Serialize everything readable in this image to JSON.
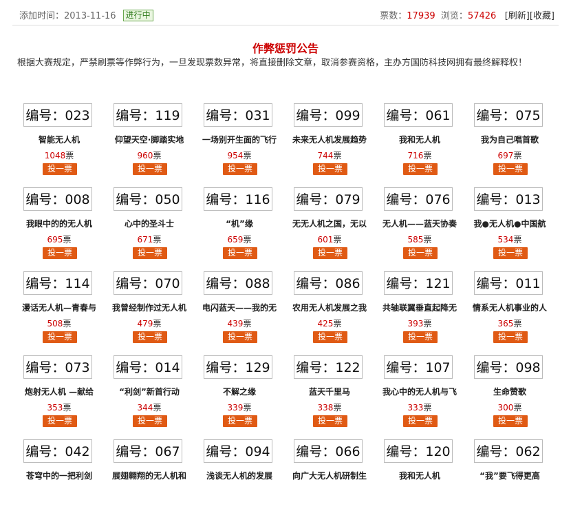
{
  "header": {
    "added_label": "添加时间：2013-11-16",
    "status_badge": "进行中",
    "votes_label": "票数：",
    "votes_value": "17939",
    "views_label": "浏览：",
    "views_value": "57426",
    "refresh_label": "[刷新]",
    "favorite_label": "[收藏]"
  },
  "notice": {
    "title": "作弊惩罚公告",
    "text": "根据大赛规定，严禁刷票等作弊行为，一旦发现票数异常，将直接删除文章，取消参赛资格，主办方国防科技网拥有最终解释权！"
  },
  "vote_button_label": "投一票",
  "votes_suffix": "票",
  "entries": [
    {
      "number": "编号：023",
      "title": "智能无人机",
      "votes": "1048"
    },
    {
      "number": "编号：119",
      "title": "仰望天空·脚踏实地",
      "votes": "960"
    },
    {
      "number": "编号：031",
      "title": "一场别开生面的飞行",
      "votes": "954"
    },
    {
      "number": "编号：099",
      "title": "未来无人机发展趋势",
      "votes": "744"
    },
    {
      "number": "编号：061",
      "title": "我和无人机",
      "votes": "716"
    },
    {
      "number": "编号：075",
      "title": "我为自己唱首歌",
      "votes": "697"
    },
    {
      "number": "编号：008",
      "title": "我眼中的的无人机",
      "votes": "695"
    },
    {
      "number": "编号：050",
      "title": "心中的圣斗士",
      "votes": "671"
    },
    {
      "number": "编号：116",
      "title": "“机”缘",
      "votes": "659"
    },
    {
      "number": "编号：079",
      "title": "无无人机之国，无以",
      "votes": "601"
    },
    {
      "number": "编号：076",
      "title": "无人机——蓝天协奏",
      "votes": "585"
    },
    {
      "number": "编号：013",
      "title": "我●无人机●中国航",
      "votes": "534"
    },
    {
      "number": "编号：114",
      "title": "漫话无人机—青春与",
      "votes": "508"
    },
    {
      "number": "编号：070",
      "title": "我曾经制作过无人机",
      "votes": "479"
    },
    {
      "number": "编号：088",
      "title": "电闪蓝天——我的无",
      "votes": "439"
    },
    {
      "number": "编号：086",
      "title": "农用无人机发展之我",
      "votes": "425"
    },
    {
      "number": "编号：121",
      "title": "共轴联翼垂直起降无",
      "votes": "393"
    },
    {
      "number": "编号：011",
      "title": "情系无人机事业的人",
      "votes": "365"
    },
    {
      "number": "编号：073",
      "title": "炮射无人机 —献给",
      "votes": "353"
    },
    {
      "number": "编号：014",
      "title": "“利剑”新首行动",
      "votes": "344"
    },
    {
      "number": "编号：129",
      "title": "不解之缘",
      "votes": "339"
    },
    {
      "number": "编号：122",
      "title": "蓝天千里马",
      "votes": "338"
    },
    {
      "number": "编号：107",
      "title": "我心中的无人机与飞",
      "votes": "333"
    },
    {
      "number": "编号：098",
      "title": "生命赞歌",
      "votes": "300"
    },
    {
      "number": "编号：042",
      "title": "苍穹中的一把利剑",
      "votes": ""
    },
    {
      "number": "编号：067",
      "title": "展翅翱翔的无人机和",
      "votes": ""
    },
    {
      "number": "编号：094",
      "title": "浅谈无人机的发展",
      "votes": ""
    },
    {
      "number": "编号：066",
      "title": "向广大无人机研制生",
      "votes": ""
    },
    {
      "number": "编号：120",
      "title": "我和无人机",
      "votes": ""
    },
    {
      "number": "编号：062",
      "title": "“我”要飞得更高",
      "votes": ""
    }
  ]
}
